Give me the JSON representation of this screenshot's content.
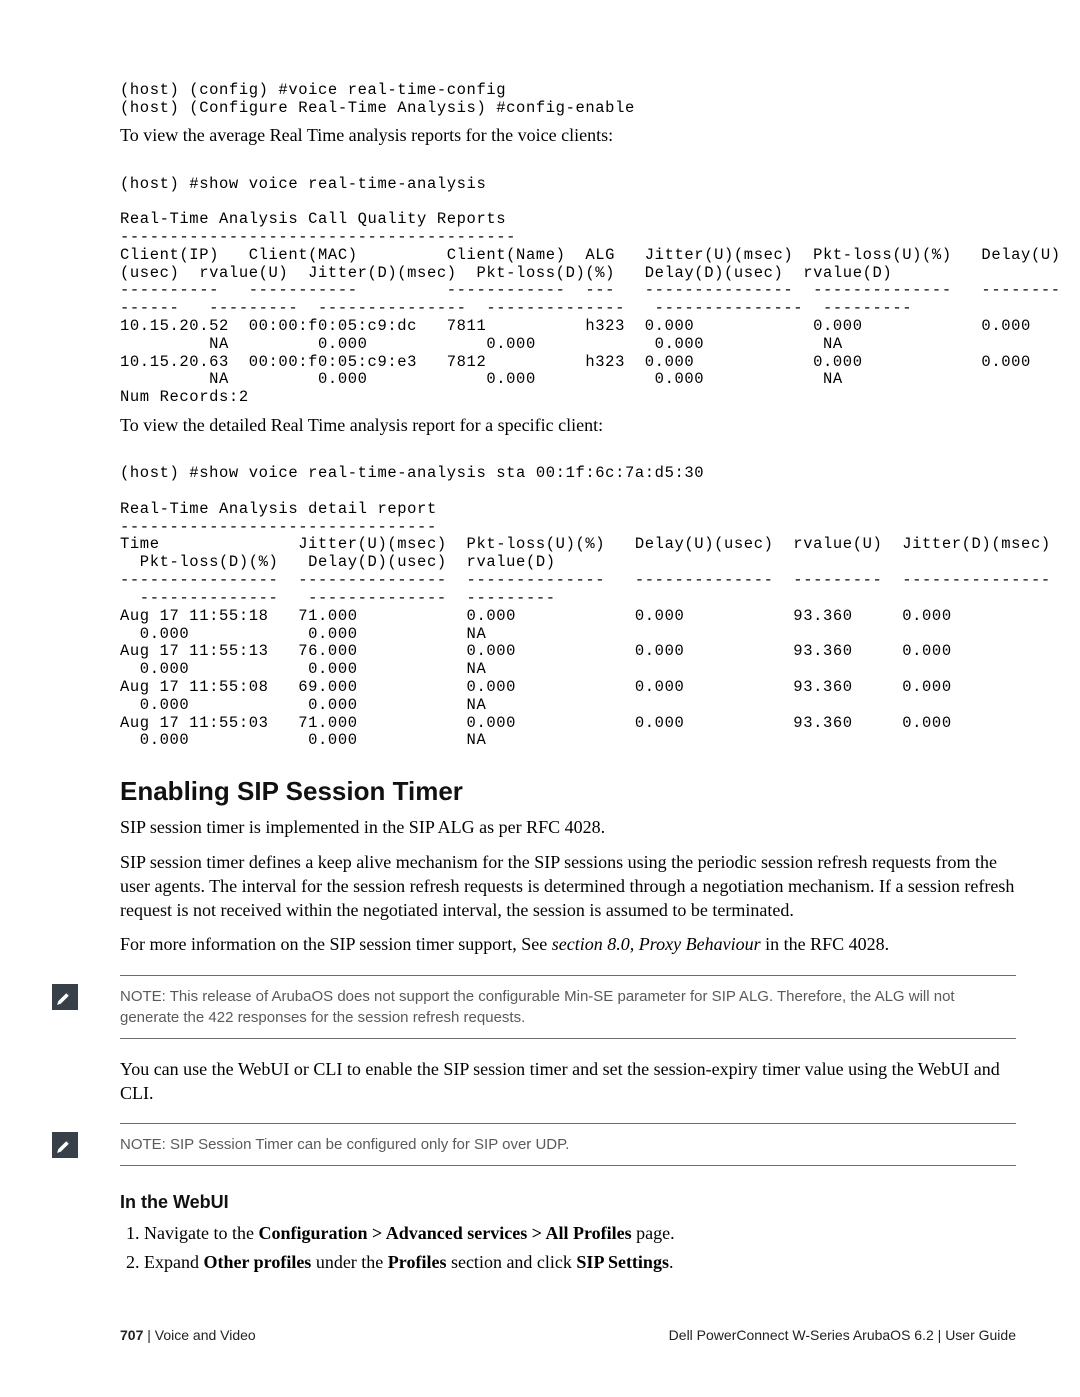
{
  "cli": {
    "cmd1": "(host) (config) #voice real-time-config",
    "cmd2": "(host) (Configure Real-Time Analysis) #config-enable",
    "intro1": "To view the average Real Time analysis reports for the voice clients:",
    "cmd3": "(host) #show voice real-time-analysis",
    "report_title": "Real-Time Analysis Call Quality Reports",
    "report_dash": "----------------------------------------",
    "col_header1": "Client(IP)   Client(MAC)         Client(Name)  ALG   Jitter(U)(msec)  Pkt-loss(U)(%)   Delay(U)",
    "col_header2": "(usec)  rvalue(U)  Jitter(D)(msec)  Pkt-loss(D)(%)   Delay(D)(usec)  rvalue(D)",
    "dash_row1": "----------   -----------         ------------  ---   ---------------  --------------   --------",
    "dash_row2": "------   ---------  ---------------  --------------   ---------------  ---------",
    "row1a": "10.15.20.52  00:00:f0:05:c9:dc   7811          h323  0.000            0.000            0.000",
    "row1b": "         NA         0.000            0.000            0.000            NA",
    "row2a": "10.15.20.63  00:00:f0:05:c9:e3   7812          h323  0.000            0.000            0.000",
    "row2b": "         NA         0.000            0.000            0.000            NA",
    "num_records": "Num Records:2",
    "intro2": "To view the detailed Real Time analysis report for a specific client:",
    "cmd4": "(host) #show voice real-time-analysis sta 00:1f:6c:7a:d5:30",
    "detail_title": "Real-Time Analysis detail report",
    "detail_dash": "--------------------------------",
    "det_h1": "Time              Jitter(U)(msec)  Pkt-loss(U)(%)   Delay(U)(usec)  rvalue(U)  Jitter(D)(msec)",
    "det_h2": "  Pkt-loss(D)(%)   Delay(D)(usec)  rvalue(D)",
    "det_dash1": "----------------  ---------------  --------------   --------------  ---------  ---------------",
    "det_dash2": "  --------------   --------------  ---------",
    "d1a": "Aug 17 11:55:18   71.000           0.000            0.000           93.360     0.000",
    "d1b": "  0.000            0.000           NA",
    "d2a": "Aug 17 11:55:13   76.000           0.000            0.000           93.360     0.000",
    "d2b": "  0.000            0.000           NA",
    "d3a": "Aug 17 11:55:08   69.000           0.000            0.000           93.360     0.000",
    "d3b": "  0.000            0.000           NA",
    "d4a": "Aug 17 11:55:03   71.000           0.000            0.000           93.360     0.000",
    "d4b": "  0.000            0.000           NA"
  },
  "section": {
    "title": "Enabling SIP Session Timer",
    "p1": "SIP session timer is implemented in the SIP ALG as per RFC 4028.",
    "p2": "SIP session timer defines a keep alive mechanism for the SIP sessions using the periodic session refresh requests from the user agents. The interval for the session refresh requests is determined through a negotiation mechanism. If a session refresh request is not received within the negotiated interval, the session is assumed to be terminated.",
    "p3a": "For more information on the SIP session timer support, See ",
    "p3_em": "section 8.0, Proxy Behaviour",
    "p3b": " in the RFC 4028.",
    "note1": "NOTE: This release of ArubaOS does not support the configurable Min-SE parameter for SIP ALG. Therefore, the ALG will not generate the 422 responses for the session refresh requests.",
    "p4": "You can use the WebUI or CLI to enable the SIP session timer and set the session-expiry timer value using the WebUI and CLI.",
    "note2": "NOTE: SIP Session Timer can be configured only for SIP over UDP.",
    "sub": "In the WebUI",
    "step1a": "Navigate to the ",
    "step1b": "Configuration > Advanced services > All Profiles",
    "step1c": " page.",
    "step2a": "Expand ",
    "step2b": "Other profiles",
    "step2c": " under the ",
    "step2d": "Profiles",
    "step2e": " section and click ",
    "step2f": "SIP Settings",
    "step2g": "."
  },
  "footer": {
    "page": "707",
    "sep": " | ",
    "left": "Voice and Video",
    "product": "Dell PowerConnect W-Series ArubaOS 6.2  ",
    "sep2": "|  ",
    "guide": "User Guide"
  }
}
